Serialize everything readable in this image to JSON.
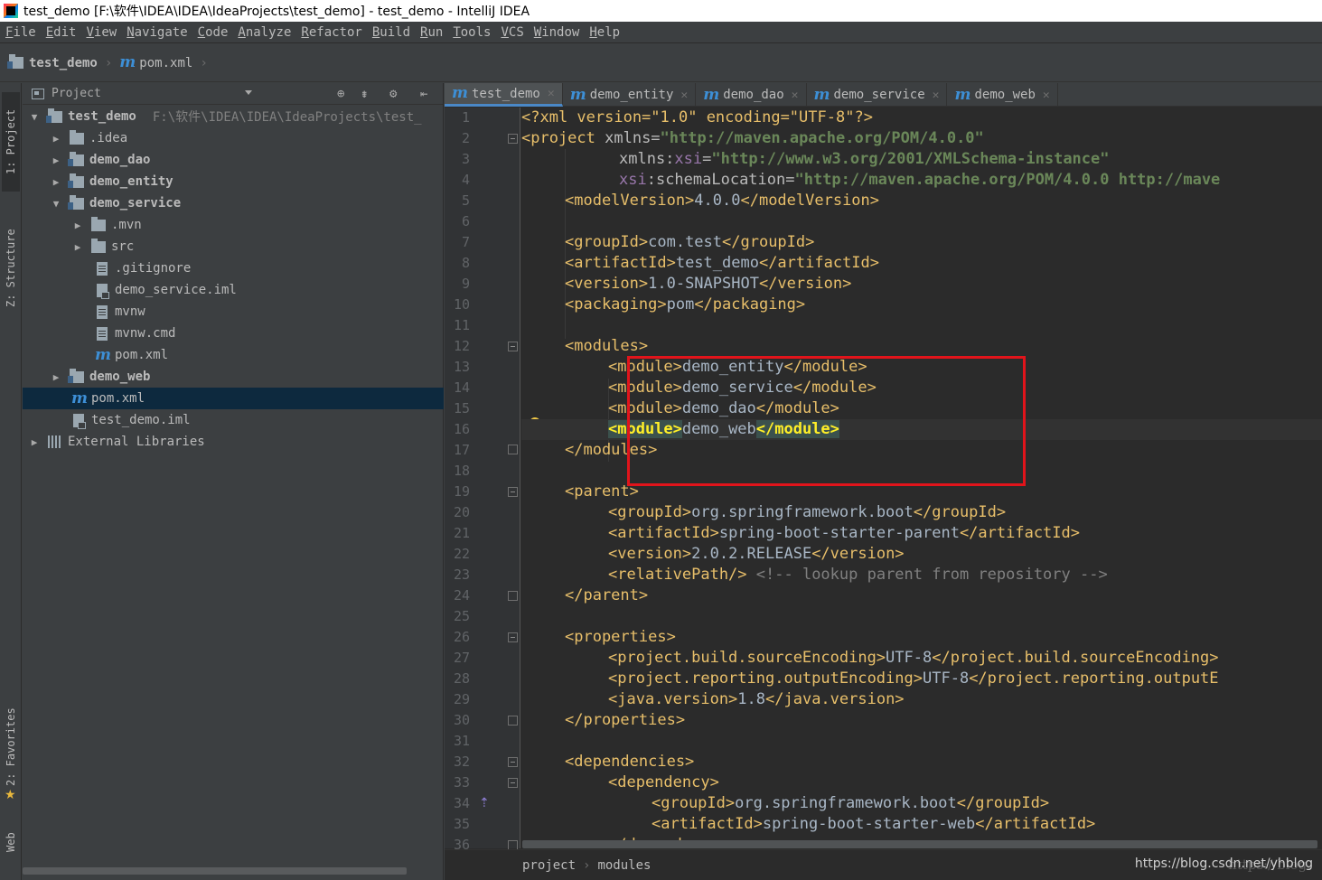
{
  "window": {
    "title": "test_demo [F:\\软件\\IDEA\\IDEA\\IdeaProjects\\test_demo] - test_demo - IntelliJ IDEA"
  },
  "menu": [
    "File",
    "Edit",
    "View",
    "Navigate",
    "Code",
    "Analyze",
    "Refactor",
    "Build",
    "Run",
    "Tools",
    "VCS",
    "Window",
    "Help"
  ],
  "navbar": {
    "project": "test_demo",
    "file": "pom.xml"
  },
  "left_stripe": {
    "project_tab": "1: Project",
    "structure_tab": "Z: Structure",
    "favorites_tab": "2: Favorites",
    "web_tab": "Web"
  },
  "project_panel": {
    "title": "Project",
    "root": {
      "name": "test_demo",
      "path": "F:\\软件\\IDEA\\IDEA\\IdeaProjects\\test_"
    },
    "items": [
      {
        "label": ".idea"
      },
      {
        "label": "demo_dao"
      },
      {
        "label": "demo_entity"
      },
      {
        "label": "demo_service"
      },
      {
        "label": ".mvn"
      },
      {
        "label": "src"
      },
      {
        "label": ".gitignore"
      },
      {
        "label": "demo_service.iml"
      },
      {
        "label": "mvnw"
      },
      {
        "label": "mvnw.cmd"
      },
      {
        "label": "pom.xml"
      },
      {
        "label": "demo_web"
      },
      {
        "label": "pom.xml"
      },
      {
        "label": "test_demo.iml"
      },
      {
        "label": "External Libraries"
      }
    ]
  },
  "editor": {
    "tabs": [
      "test_demo",
      "demo_entity",
      "demo_dao",
      "demo_service",
      "demo_web"
    ],
    "active_tab": "test_demo",
    "line_numbers": [
      "1",
      "2",
      "3",
      "4",
      "5",
      "6",
      "7",
      "8",
      "9",
      "10",
      "11",
      "12",
      "13",
      "14",
      "15",
      "16",
      "17",
      "18",
      "19",
      "20",
      "21",
      "22",
      "23",
      "24",
      "25",
      "26",
      "27",
      "28",
      "29",
      "30",
      "31",
      "32",
      "33",
      "34",
      "35",
      "36"
    ],
    "code": {
      "l1": "<?xml version=\"1.0\" encoding=\"UTF-8\"?>",
      "l2_tag": "<project ",
      "l2_attr": "xmlns=",
      "l2_val": "\"http://maven.apache.org/POM/4.0.0\"",
      "l3_attr": "xmlns:",
      "l3_ns": "xsi",
      "l3_eq": "=",
      "l3_val": "\"http://www.w3.org/2001/XMLSchema-instance\"",
      "l4_ns": "xsi",
      "l4_attr": ":schemaLocation=",
      "l4_val": "\"http://maven.apache.org/POM/4.0.0 http://mave",
      "l5_open": "<modelVersion>",
      "l5_text": "4.0.0",
      "l5_close": "</modelVersion>",
      "l7_open": "<groupId>",
      "l7_text": "com.test",
      "l7_close": "</groupId>",
      "l8_open": "<artifactId>",
      "l8_text": "test_demo",
      "l8_close": "</artifactId>",
      "l9_open": "<version>",
      "l9_text": "1.0-SNAPSHOT",
      "l9_close": "</version>",
      "l10_open": "<packaging>",
      "l10_text": "pom",
      "l10_close": "</packaging>",
      "l12": "<modules>",
      "l13_open": "<module>",
      "l13_text": "demo_entity",
      "l13_close": "</module>",
      "l14_open": "<module>",
      "l14_text": "demo_service",
      "l14_close": "</module>",
      "l15_open": "<module>",
      "l15_text": "demo_dao",
      "l15_close": "</module>",
      "l16_open": "<module>",
      "l16_text": "demo_web",
      "l16_close": "</module>",
      "l17": "</modules>",
      "l19": "<parent>",
      "l20_open": "<groupId>",
      "l20_text": "org.springframework.boot",
      "l20_close": "</groupId>",
      "l21_open": "<artifactId>",
      "l21_text": "spring-boot-starter-parent",
      "l21_close": "</artifactId>",
      "l22_open": "<version>",
      "l22_text": "2.0.2.RELEASE",
      "l22_close": "</version>",
      "l23_tag": "<relativePath/>",
      "l23_comment": "<!-- lookup parent from repository -->",
      "l24": "</parent>",
      "l26": "<properties>",
      "l27_open": "<project.build.sourceEncoding>",
      "l27_text": "UTF-8",
      "l27_close": "</project.build.sourceEncoding>",
      "l28_open": "<project.reporting.outputEncoding>",
      "l28_text": "UTF-8",
      "l28_close": "</project.reporting.outputE",
      "l29_open": "<java.version>",
      "l29_text": "1.8",
      "l29_close": "</java.version>",
      "l30": "</properties>",
      "l32": "<dependencies>",
      "l33": "<dependency>",
      "l34_open": "<groupId>",
      "l34_text": "org.springframework.boot",
      "l34_close": "</groupId>",
      "l35_open": "<artifactId>",
      "l35_text": "spring-boot-starter-web",
      "l35_close": "</artifactId>",
      "l36": "</dependency>"
    },
    "breadcrumb": [
      "project",
      "modules"
    ],
    "watermark": "https://blog.csdn.net/yhblog",
    "watermark_faint": "https://blog."
  },
  "colors": {
    "tag": "#e8bf6a",
    "attr_value": "#6a8759",
    "highlight_box": "#e1141b",
    "selection": "#0d293e"
  }
}
